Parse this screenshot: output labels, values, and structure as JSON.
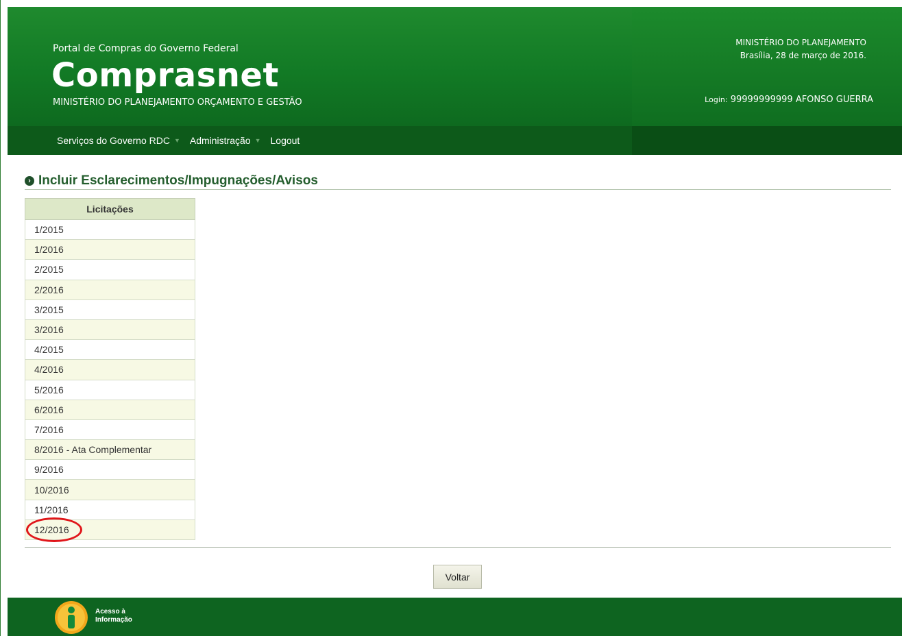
{
  "header": {
    "portal_subtitle": "Portal de Compras do Governo Federal",
    "app_title": "Comprasnet",
    "ministry_subtitle": "MINISTÉRIO DO PLANEJAMENTO ORÇAMENTO E GESTÃO",
    "ministry_right": "MINISTÉRIO DO PLANEJAMENTO",
    "date_line": "Brasília, 28 de março de 2016.",
    "login_label": "Login:",
    "login_value": "99999999999 AFONSO GUERRA"
  },
  "nav": {
    "items": [
      {
        "label": "Serviços do Governo RDC",
        "has_dropdown": true
      },
      {
        "label": "Administração",
        "has_dropdown": true
      },
      {
        "label": "Logout",
        "has_dropdown": false
      }
    ]
  },
  "main": {
    "title": "Incluir Esclarecimentos/Impugnações/Avisos",
    "table": {
      "header": "Licitações",
      "rows": [
        "1/2015",
        "1/2016",
        "2/2015",
        "2/2016",
        "3/2015",
        "3/2016",
        "4/2015",
        "4/2016",
        "5/2016",
        "6/2016",
        "7/2016",
        "8/2016 - Ata Complementar",
        "9/2016",
        "10/2016",
        "11/2016",
        "12/2016"
      ]
    },
    "back_button": "Voltar"
  },
  "footer": {
    "acesso_line1": "Acesso à",
    "acesso_line2": "Informação"
  },
  "colors": {
    "header_green": "#1f8a2e",
    "nav_green": "#0d5a1a",
    "highlight_circle": "#e0161a"
  }
}
